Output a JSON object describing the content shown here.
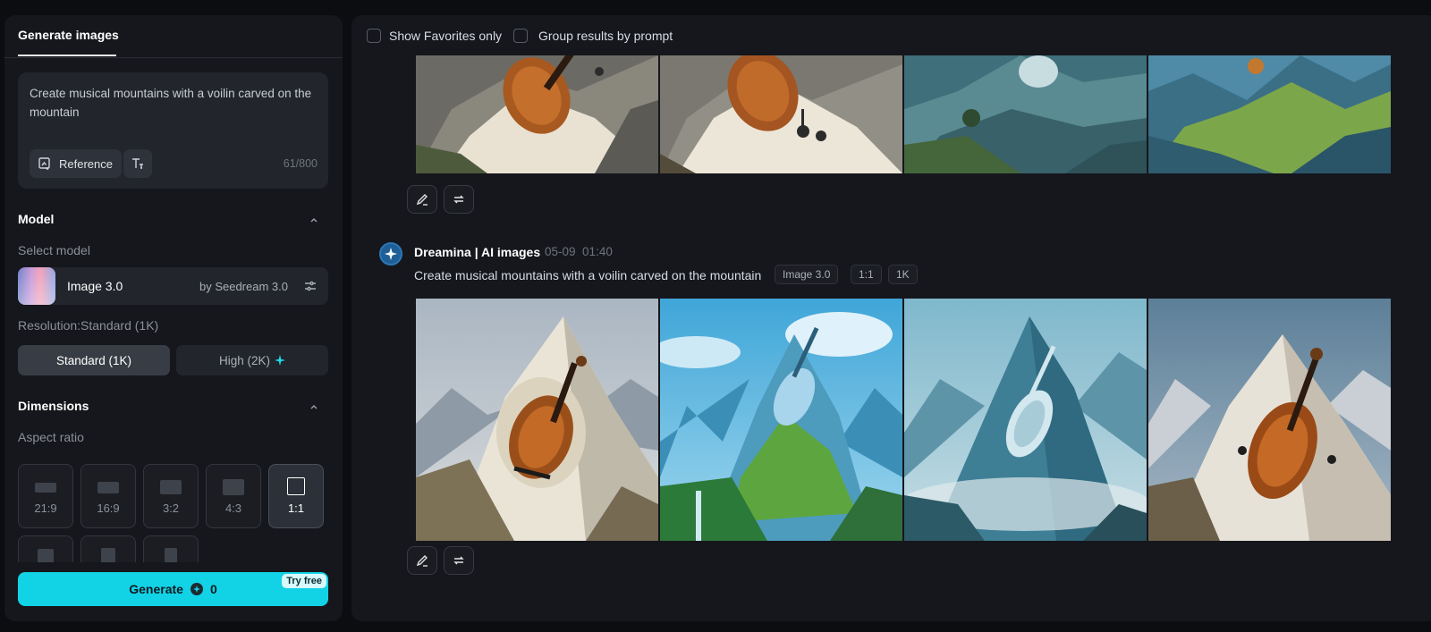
{
  "left_panel": {
    "tab_label": "Generate images",
    "prompt": {
      "text": "Create musical mountains with a voilin carved on the mountain",
      "reference_label": "Reference",
      "char_count": "61/800"
    },
    "model_section": {
      "title": "Model",
      "select_label": "Select model",
      "model_name": "Image 3.0",
      "model_by": "by Seedream 3.0"
    },
    "resolution": {
      "label": "Resolution:Standard (1K)",
      "options": [
        "Standard (1K)",
        "High (2K)"
      ],
      "selected": "Standard (1K)"
    },
    "dimensions": {
      "title": "Dimensions",
      "aspect_label": "Aspect ratio",
      "ratios": [
        "21:9",
        "16:9",
        "3:2",
        "4:3",
        "1:1"
      ],
      "selected_ratio": "1:1"
    },
    "generate": {
      "label": "Generate",
      "credits": "0",
      "badge": "Try free"
    }
  },
  "right_panel": {
    "filters": {
      "favorites_label": "Show Favorites only",
      "group_label": "Group results by prompt"
    },
    "result": {
      "app_name": "Dreamina | AI images",
      "date": "05-09",
      "time": "01:40",
      "prompt": "Create musical mountains with a voilin carved on the mountain",
      "tags": [
        "Image 3.0",
        "1:1",
        "1K"
      ]
    }
  },
  "icons": [
    "reference-icon",
    "text-format-icon",
    "chevron-up-icon",
    "settings-sliders-icon",
    "sparkle-icon",
    "edit-icon",
    "regenerate-icon",
    "dreamina-logo-icon",
    "credit-icon"
  ],
  "colors": {
    "accent": "#12d3e5",
    "panel": "#15171c",
    "page": "#0c0d10"
  }
}
